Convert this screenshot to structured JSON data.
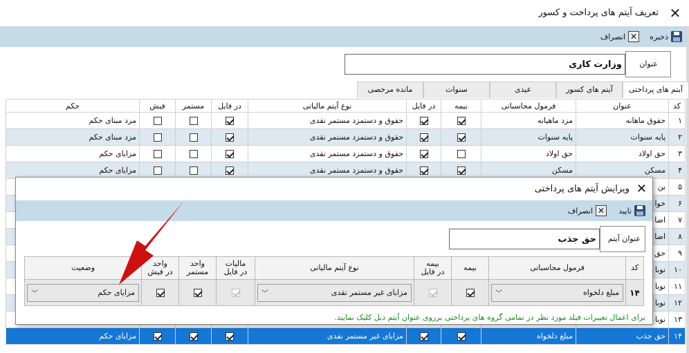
{
  "window": {
    "title": "تعریف آیتم های پرداخت و کسور"
  },
  "toolbar": {
    "save_label": "ذخیره",
    "cancel_label": "انصراف"
  },
  "form": {
    "title_label": "عنوان",
    "title_value": "وزارت کاری"
  },
  "tabs": [
    "آیتم های پرداختی",
    "آیتم های کسور",
    "عیدی",
    "سنوات",
    "مانده مرخصی"
  ],
  "grid": {
    "headers": [
      "کد",
      "عنوان",
      "فرمول محاسباتی",
      "بیمه",
      "در فایل",
      "نوع آیتم مالیاتی",
      "در فایل",
      "مستمر",
      "فیش",
      "حکم"
    ],
    "rows": [
      {
        "code": "۱",
        "title": "حقوق ماهانه",
        "formula": "مزد ماهیانه",
        "bimeh": true,
        "file1": true,
        "tax": "حقوق و دستمزد مستمر نقدی",
        "file2": true,
        "mostamar": false,
        "fish": false,
        "hokm": "مزد مبنای حکم"
      },
      {
        "code": "۲",
        "title": "پایه سنوات",
        "formula": "پایه سنوات",
        "bimeh": true,
        "file1": true,
        "tax": "حقوق و دستمزد مستمر نقدی",
        "file2": true,
        "mostamar": false,
        "fish": false,
        "hokm": "مزد مبنای حکم"
      },
      {
        "code": "۳",
        "title": "حق اولاد",
        "formula": "حق اولاد",
        "bimeh": false,
        "file1": true,
        "tax": "حقوق و دستمزد مستمر نقدی",
        "file2": true,
        "mostamar": false,
        "fish": false,
        "hokm": "مزایای حکم"
      },
      {
        "code": "۴",
        "title": "مسکن",
        "formula": "مسکن",
        "bimeh": true,
        "file1": true,
        "tax": "حقوق و دستمزد مستمر نقدی",
        "file2": true,
        "mostamar": false,
        "fish": false,
        "hokm": "مزایای حکم"
      },
      {
        "code": "۵",
        "title": "بن",
        "formula": "",
        "bimeh": false,
        "file1": false,
        "tax": "",
        "file2": false,
        "mostamar": false,
        "fish": false,
        "hokm": ""
      },
      {
        "code": "۶",
        "title": "خوا",
        "formula": "",
        "bimeh": false,
        "file1": false,
        "tax": "",
        "file2": false,
        "mostamar": false,
        "fish": false,
        "hokm": ""
      },
      {
        "code": "۷",
        "title": "اضا",
        "formula": "",
        "bimeh": false,
        "file1": false,
        "tax": "",
        "file2": false,
        "mostamar": false,
        "fish": false,
        "hokm": ""
      },
      {
        "code": "۸",
        "title": "اضا",
        "formula": "",
        "bimeh": false,
        "file1": false,
        "tax": "",
        "file2": false,
        "mostamar": false,
        "fish": false,
        "hokm": ""
      },
      {
        "code": "۹",
        "title": "حق",
        "formula": "",
        "bimeh": false,
        "file1": false,
        "tax": "",
        "file2": false,
        "mostamar": false,
        "fish": false,
        "hokm": ""
      },
      {
        "code": "۱۰",
        "title": "نوبا",
        "formula": "",
        "bimeh": false,
        "file1": false,
        "tax": "",
        "file2": false,
        "mostamar": false,
        "fish": false,
        "hokm": ""
      },
      {
        "code": "۱۱",
        "title": "نوبا",
        "formula": "",
        "bimeh": false,
        "file1": false,
        "tax": "",
        "file2": false,
        "mostamar": false,
        "fish": false,
        "hokm": ""
      },
      {
        "code": "۱۲",
        "title": "نوبا",
        "formula": "",
        "bimeh": false,
        "file1": false,
        "tax": "",
        "file2": false,
        "mostamar": false,
        "fish": false,
        "hokm": ""
      },
      {
        "code": "۱۳",
        "title": "نوبا",
        "formula": "",
        "bimeh": false,
        "file1": false,
        "tax": "",
        "file2": false,
        "mostamar": false,
        "fish": false,
        "hokm": ""
      },
      {
        "code": "۱۴",
        "title": "حق جذب",
        "formula": "مبلغ دلخواه",
        "bimeh": true,
        "file1": true,
        "tax": "مزایای غیر مستمر نقدی",
        "file2": true,
        "mostamar": true,
        "fish": true,
        "hokm": "مزایای حکم"
      }
    ]
  },
  "dialog": {
    "title": "ویرایش آیتم های پرداختی",
    "confirm_label": "تایید",
    "cancel_label": "انصراف",
    "item_title_label": "عنوان آیتم",
    "item_title_value": "حق جذب",
    "headers": {
      "code": "کد",
      "formula": "فرمول محاسباتی",
      "bimeh": "بیمه",
      "bimeh_file_1": "بیمه",
      "bimeh_file_2": "در فایل",
      "tax": "نوع آیتم مالیاتی",
      "tax_file_1": "مالیات",
      "tax_file_2": "در فایل",
      "mostamar_1": "واحد",
      "mostamar_2": "مستمر",
      "fish_1": "واحد",
      "fish_2": "در فیش",
      "status": "وضعیت"
    },
    "row": {
      "code": "۱۴",
      "formula": "مبلغ دلخواه",
      "tax": "مزایای غیر مستمر نقدی",
      "status": "مزایای حکم"
    },
    "note": "برای اعمال تغییرات فیلد مورد نظر در تمامی گروه های پرداختی برروی عنوان آیتم دبل کلیک نمایید."
  },
  "colors": {
    "toolbar": "#c6dbe8",
    "selected_row": "#1577d6",
    "alt_row": "#dde8f0",
    "note": "#1a8a1a",
    "arrow": "#d01010"
  }
}
